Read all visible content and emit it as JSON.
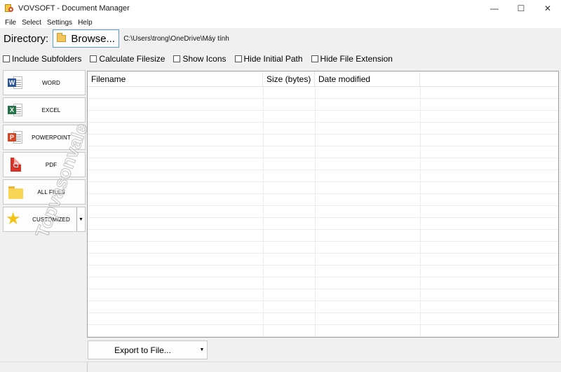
{
  "window": {
    "title": "VOVSOFT - Document Manager",
    "minimize": "—",
    "maximize": "☐",
    "close": "✕"
  },
  "menu": [
    "File",
    "Select",
    "Settings",
    "Help"
  ],
  "directory": {
    "label": "Directory:",
    "browse_label": "Browse...",
    "path": "C:\\Users\\trong\\OneDrive\\Máy tính"
  },
  "options": [
    {
      "label": "Include Subfolders",
      "checked": false
    },
    {
      "label": "Calculate Filesize",
      "checked": false
    },
    {
      "label": "Show Icons",
      "checked": false
    },
    {
      "label": "Hide Initial Path",
      "checked": false
    },
    {
      "label": "Hide File Extension",
      "checked": false
    }
  ],
  "categories": [
    {
      "label": "WORD",
      "icon": "word-icon"
    },
    {
      "label": "EXCEL",
      "icon": "excel-icon"
    },
    {
      "label": "POWERPOINT",
      "icon": "powerpoint-icon"
    },
    {
      "label": "PDF",
      "icon": "pdf-icon"
    },
    {
      "label": "ALL FILES",
      "icon": "folder-icon"
    },
    {
      "label": "CUSTOMIZED",
      "icon": "star-icon"
    }
  ],
  "table": {
    "columns": [
      "Filename",
      "Size (bytes)",
      "Date modified"
    ],
    "rows": []
  },
  "export": {
    "label": "Export to File..."
  },
  "watermark": "Topvasonvale",
  "colors": {
    "accent": "#5b9bd5",
    "word": "#2b579a",
    "excel": "#217346",
    "powerpoint": "#d24726",
    "pdf": "#d93025",
    "folder": "#f8d354",
    "star": "#f2c314"
  }
}
